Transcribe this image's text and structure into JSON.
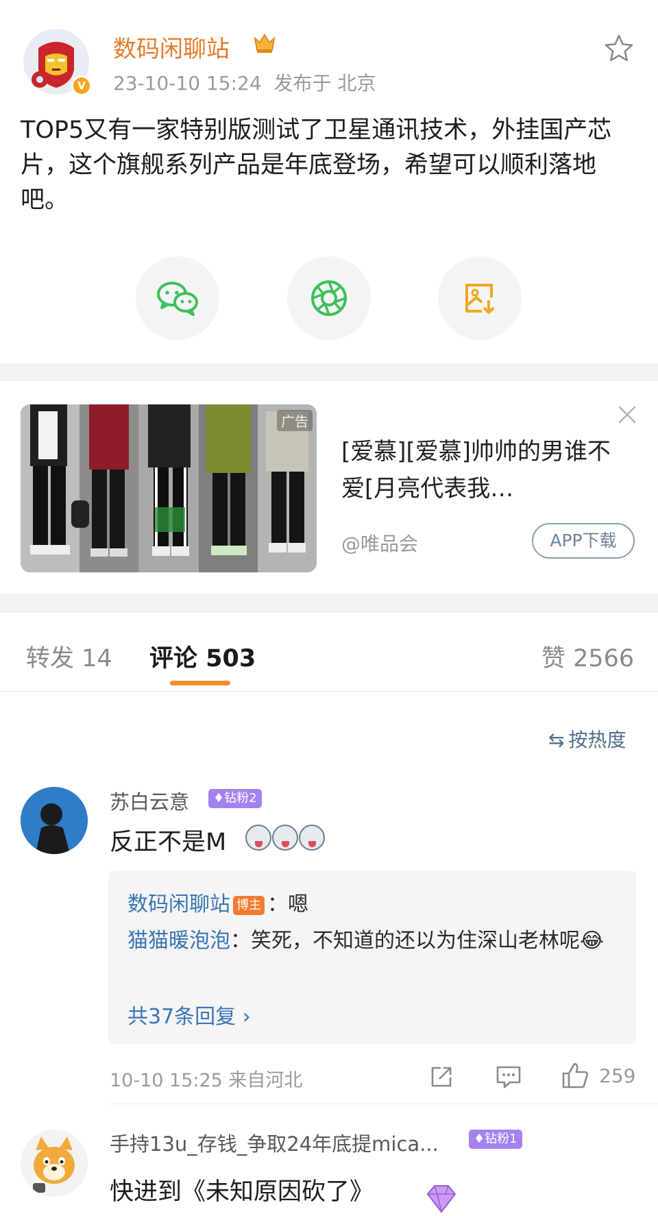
{
  "post": {
    "author": "数码闲聊站",
    "verified_mark": "V",
    "timestamp": "23-10-10 15:24",
    "location_label": "发布于 北京",
    "text": "TOP5又有一家特别版测试了卫星通讯技术，外挂国产芯片，这个旗舰系列产品是年底登场，希望可以顺利落地吧。",
    "icons": {
      "crown": "crown-badge-icon",
      "favorite": "star-icon"
    },
    "share_icons": [
      "wechat-icon",
      "moments-shutter-icon",
      "save-image-icon"
    ]
  },
  "ad": {
    "tag": "广告",
    "text": "[爱慕][爱慕]帅帅的男谁不爱[月亮代表我…",
    "source": "@唯品会",
    "button": "APP下载",
    "close_icon": "close-icon"
  },
  "tabs": {
    "repost": "转发 14",
    "comments": "评论 503",
    "likes": "赞 2566"
  },
  "sort": {
    "icon": "⇆",
    "label": "按热度"
  },
  "comments": [
    {
      "name": "苏白云意",
      "badge": "钻粉2",
      "text": "反正不是M",
      "replies": [
        {
          "name": "数码闲聊站",
          "badge": "博主",
          "text": "：嗯"
        },
        {
          "name": "猫猫暖泡泡",
          "text": "：笑死，不知道的还以为住深山老林呢😂"
        }
      ],
      "more_replies": "共37条回复 ›",
      "meta": "10-10 15:25 来自河北",
      "like_count": "259"
    },
    {
      "name": "手持13u_存钱_争取24年底提mica...",
      "badge": "钻粉1",
      "text": "快进到《未知原因砍了》"
    }
  ],
  "colors": {
    "author_orange": "#e47b2c",
    "tab_accent": "#f28c28",
    "link_blue": "#3a74b4",
    "fan_badge_purple": "#a382f0",
    "blogger_badge_orange": "#f47a2e",
    "wechat_green": "#3cbf5a",
    "save_yellow": "#f0a51e"
  }
}
